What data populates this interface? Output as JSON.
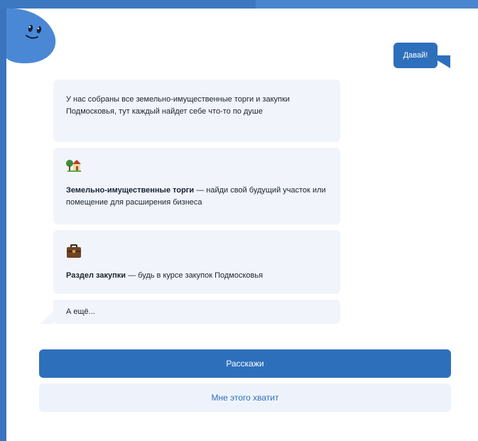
{
  "chat": {
    "user_reply": "Давай!",
    "messages": {
      "intro": "У нас собраны все земельно-имущественные торги и закупки Подмосковья, тут каждый найдет себе что-то по душе",
      "land": {
        "icon": "house-with-garden-emoji",
        "title": "Земельно-имущественные торги",
        "text": " — найди свой будущий участок или помещение для расширения бизнеса"
      },
      "procurement": {
        "icon": "briefcase-emoji",
        "title": "Раздел закупки",
        "text": " — будь в курсе закупок Подмосковья"
      },
      "more": "А ещё..."
    }
  },
  "buttons": {
    "primary": "Расскажи",
    "secondary": "Мне этого хватит"
  },
  "colors": {
    "brand_blue": "#2e6fbc",
    "bubble_gray": "#f1f4fa",
    "secondary_button_bg": "#eef3fb"
  }
}
